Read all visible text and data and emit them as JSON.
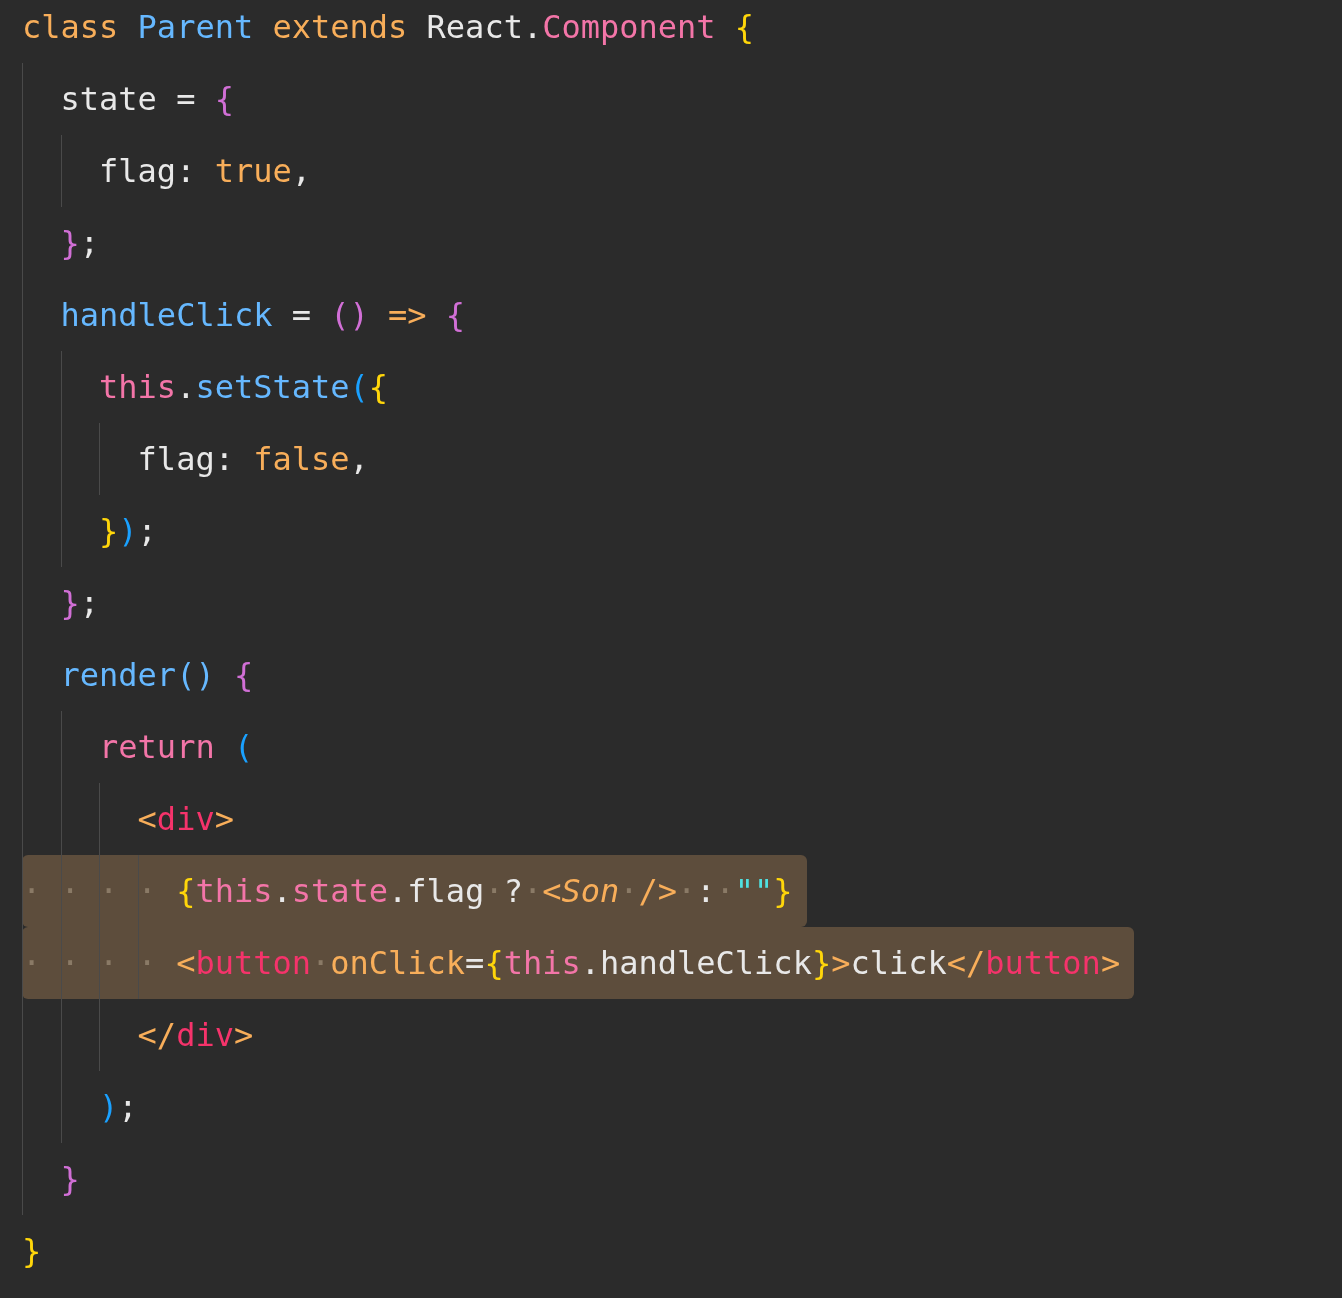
{
  "editor": {
    "lines": [
      {
        "selected": false,
        "tokens": [
          {
            "text": "class ",
            "color": "#f8ae5a"
          },
          {
            "text": "Parent ",
            "color": "#66b8ff"
          },
          {
            "text": "extends ",
            "color": "#f8ae5a"
          },
          {
            "text": "React.",
            "color": "#e8e8e8"
          },
          {
            "text": "Component ",
            "color": "#f375a8"
          },
          {
            "text": "{",
            "color": "#ffd60a"
          }
        ]
      },
      {
        "selected": false,
        "tokens": [
          {
            "text": "  state = ",
            "color": "#e8e8e8"
          },
          {
            "text": "{",
            "color": "#d16fd6"
          }
        ]
      },
      {
        "selected": false,
        "tokens": [
          {
            "text": "    flag: ",
            "color": "#e8e8e8"
          },
          {
            "text": "true",
            "color": "#f8ae5a"
          },
          {
            "text": ",",
            "color": "#e8e8e8"
          }
        ]
      },
      {
        "selected": false,
        "tokens": [
          {
            "text": "  }",
            "color": "#d16fd6"
          },
          {
            "text": ";",
            "color": "#e8e8e8"
          }
        ]
      },
      {
        "selected": false,
        "tokens": [
          {
            "text": "  handleClick",
            "color": "#66b8ff"
          },
          {
            "text": " = ",
            "color": "#e8e8e8"
          },
          {
            "text": "()",
            "color": "#d16fd6"
          },
          {
            "text": " => ",
            "color": "#f8ae5a"
          },
          {
            "text": "{",
            "color": "#d16fd6"
          }
        ]
      },
      {
        "selected": false,
        "tokens": [
          {
            "text": "    this",
            "color": "#f375a8"
          },
          {
            "text": ".",
            "color": "#e8e8e8"
          },
          {
            "text": "setState",
            "color": "#66b8ff"
          },
          {
            "text": "(",
            "color": "#1aa1ff"
          },
          {
            "text": "{",
            "color": "#ffd60a"
          }
        ]
      },
      {
        "selected": false,
        "tokens": [
          {
            "text": "      flag: ",
            "color": "#e8e8e8"
          },
          {
            "text": "false",
            "color": "#f8ae5a"
          },
          {
            "text": ",",
            "color": "#e8e8e8"
          }
        ]
      },
      {
        "selected": false,
        "tokens": [
          {
            "text": "    }",
            "color": "#ffd60a"
          },
          {
            "text": ")",
            "color": "#1aa1ff"
          },
          {
            "text": ";",
            "color": "#e8e8e8"
          }
        ]
      },
      {
        "selected": false,
        "tokens": [
          {
            "text": "  }",
            "color": "#d16fd6"
          },
          {
            "text": ";",
            "color": "#e8e8e8"
          }
        ]
      },
      {
        "selected": false,
        "tokens": [
          {
            "text": "  render() ",
            "color": "#66b8ff"
          },
          {
            "text": "{",
            "color": "#d16fd6"
          }
        ]
      },
      {
        "selected": false,
        "tokens": [
          {
            "text": "    return ",
            "color": "#f375a8"
          },
          {
            "text": "(",
            "color": "#1aa1ff"
          }
        ]
      },
      {
        "selected": false,
        "tokens": [
          {
            "text": "      <",
            "color": "#f8ae5a"
          },
          {
            "text": "div",
            "color": "#f5336b"
          },
          {
            "text": ">",
            "color": "#f8ae5a"
          }
        ]
      },
      {
        "selected": true,
        "tokens": [
          {
            "text": "· · · · ",
            "color": "#8a7a66"
          },
          {
            "text": "{",
            "color": "#ffd60a"
          },
          {
            "text": "this",
            "color": "#f375a8"
          },
          {
            "text": ".",
            "color": "#e8e8e8"
          },
          {
            "text": "state",
            "color": "#f375a8"
          },
          {
            "text": ".flag",
            "color": "#e8e8e8"
          },
          {
            "text": "·",
            "color": "#8a7a66"
          },
          {
            "text": "?",
            "color": "#e8e8e8"
          },
          {
            "text": "·",
            "color": "#8a7a66"
          },
          {
            "text": "<",
            "color": "#f8ae5a"
          },
          {
            "text": "Son",
            "color": "#f8ae5a",
            "italic": true
          },
          {
            "text": "·",
            "color": "#8a7a66"
          },
          {
            "text": "/>",
            "color": "#f8ae5a"
          },
          {
            "text": "·",
            "color": "#8a7a66"
          },
          {
            "text": ":",
            "color": "#e8e8e8"
          },
          {
            "text": "·",
            "color": "#8a7a66"
          },
          {
            "text": "\"\"",
            "color": "#4fe0e0"
          },
          {
            "text": "}",
            "color": "#ffd60a"
          }
        ]
      },
      {
        "selected": true,
        "tokens": [
          {
            "text": "· · · · ",
            "color": "#8a7a66"
          },
          {
            "text": "<",
            "color": "#f8ae5a"
          },
          {
            "text": "button",
            "color": "#f5336b"
          },
          {
            "text": "·",
            "color": "#8a7a66"
          },
          {
            "text": "onClick",
            "color": "#f8ae5a"
          },
          {
            "text": "=",
            "color": "#e8e8e8"
          },
          {
            "text": "{",
            "color": "#ffd60a"
          },
          {
            "text": "this",
            "color": "#f375a8"
          },
          {
            "text": ".handleClick",
            "color": "#e8e8e8"
          },
          {
            "text": "}",
            "color": "#ffd60a"
          },
          {
            "text": ">",
            "color": "#f8ae5a"
          },
          {
            "text": "click",
            "color": "#e8e8e8"
          },
          {
            "text": "</",
            "color": "#f8ae5a"
          },
          {
            "text": "button",
            "color": "#f5336b"
          },
          {
            "text": ">",
            "color": "#f8ae5a"
          }
        ]
      },
      {
        "selected": false,
        "tokens": [
          {
            "text": "      </",
            "color": "#f8ae5a"
          },
          {
            "text": "div",
            "color": "#f5336b"
          },
          {
            "text": ">",
            "color": "#f8ae5a"
          }
        ]
      },
      {
        "selected": false,
        "tokens": [
          {
            "text": "    )",
            "color": "#1aa1ff"
          },
          {
            "text": ";",
            "color": "#e8e8e8"
          }
        ]
      },
      {
        "selected": false,
        "tokens": [
          {
            "text": "  }",
            "color": "#d16fd6"
          }
        ]
      },
      {
        "selected": false,
        "tokens": [
          {
            "text": "}",
            "color": "#ffd60a"
          }
        ]
      }
    ]
  }
}
